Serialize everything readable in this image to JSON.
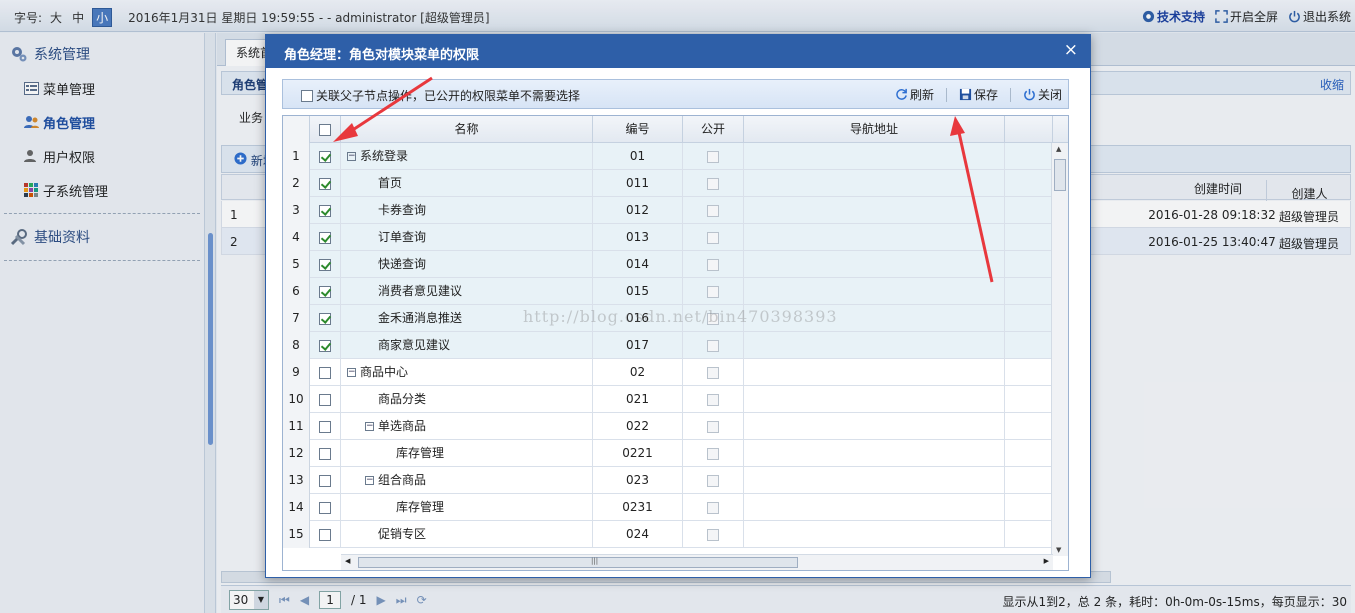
{
  "topbar": {
    "font_label": "字号:",
    "font_sizes": [
      "大",
      "中",
      "小"
    ],
    "datetime_user": "2016年1月31日 星期日 19:59:55 - - administrator [超级管理员]",
    "tech_support": "技术支持",
    "fullscreen": "开启全屏",
    "logout": "退出系统"
  },
  "sidebar": {
    "group1": "系统管理",
    "items": [
      "菜单管理",
      "角色管理",
      "用户权限",
      "子系统管理"
    ],
    "group2": "基础资料"
  },
  "main": {
    "tab": "系统首",
    "panel_title": "角色管",
    "collapse": "收缩",
    "biz": "业务",
    "add": "新增",
    "col_created": "创建时间",
    "col_creator": "创建人",
    "rows": [
      {
        "n": "1",
        "date": "2016-01-28 09:18:32",
        "user": "超级管理员"
      },
      {
        "n": "2",
        "date": "2016-01-25 13:40:47",
        "user": "超级管理员"
      }
    ],
    "pager": {
      "size": "30",
      "page": "1",
      "total": "/ 1",
      "status": "显示从1到2，总 2 条，耗时：0h-0m-0s-15ms，每页显示：30"
    }
  },
  "modal": {
    "title": "角色经理：角色对模块菜单的权限",
    "close": "×",
    "link_label": "关联父子节点操作，已公开的权限菜单不需要选择",
    "refresh": "刷新",
    "save": "保存",
    "close_btn": "关闭",
    "headers": {
      "name": "名称",
      "code": "编号",
      "public": "公开",
      "url": "导航地址"
    },
    "rows": [
      {
        "n": "1",
        "name": "系统登录",
        "code": "01",
        "checked": true,
        "level": 0,
        "expander": true
      },
      {
        "n": "2",
        "name": "首页",
        "code": "011",
        "checked": true,
        "level": 1,
        "expander": false
      },
      {
        "n": "3",
        "name": "卡券查询",
        "code": "012",
        "checked": true,
        "level": 1,
        "expander": false
      },
      {
        "n": "4",
        "name": "订单查询",
        "code": "013",
        "checked": true,
        "level": 1,
        "expander": false
      },
      {
        "n": "5",
        "name": "快递查询",
        "code": "014",
        "checked": true,
        "level": 1,
        "expander": false
      },
      {
        "n": "6",
        "name": "消费者意见建议",
        "code": "015",
        "checked": true,
        "level": 1,
        "expander": false
      },
      {
        "n": "7",
        "name": "金禾通消息推送",
        "code": "016",
        "checked": true,
        "level": 1,
        "expander": false
      },
      {
        "n": "8",
        "name": "商家意见建议",
        "code": "017",
        "checked": true,
        "level": 1,
        "expander": false
      },
      {
        "n": "9",
        "name": "商品中心",
        "code": "02",
        "checked": false,
        "level": 0,
        "expander": true
      },
      {
        "n": "10",
        "name": "商品分类",
        "code": "021",
        "checked": false,
        "level": 1,
        "expander": false
      },
      {
        "n": "11",
        "name": "单选商品",
        "code": "022",
        "checked": false,
        "level": 1,
        "expander": true
      },
      {
        "n": "12",
        "name": "库存管理",
        "code": "0221",
        "checked": false,
        "level": 2,
        "expander": false
      },
      {
        "n": "13",
        "name": "组合商品",
        "code": "023",
        "checked": false,
        "level": 1,
        "expander": true
      },
      {
        "n": "14",
        "name": "库存管理",
        "code": "0231",
        "checked": false,
        "level": 2,
        "expander": false
      },
      {
        "n": "15",
        "name": "促销专区",
        "code": "024",
        "checked": false,
        "level": 1,
        "expander": false
      }
    ]
  },
  "watermark": "http://blog.csdn.net/bin470398393",
  "colors": {
    "accent": "#2e5fa8",
    "arrow": "#e8383d"
  }
}
